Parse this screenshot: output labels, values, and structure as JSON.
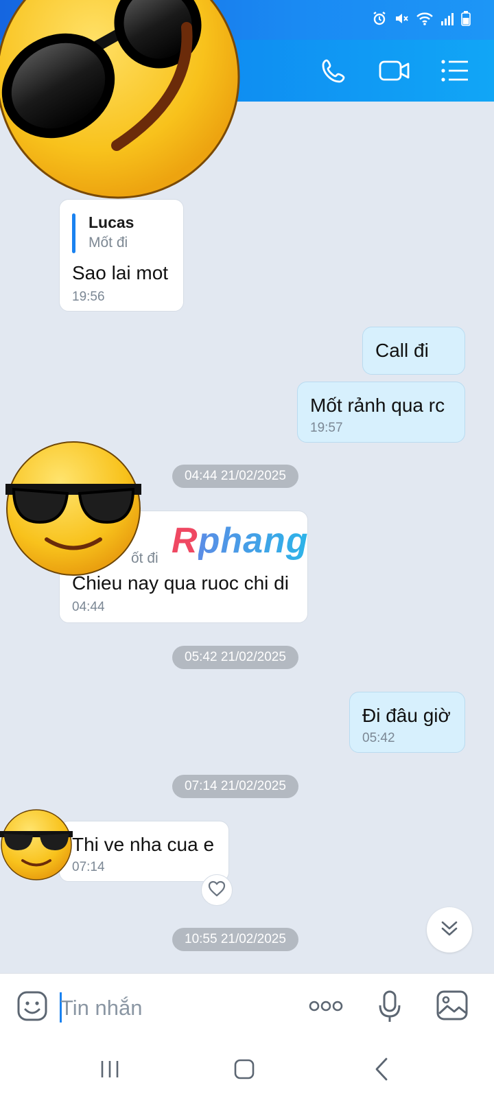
{
  "colors": {
    "accent": "#1a82f0",
    "header_start": "#0e7cf0",
    "header_end": "#11a6f6",
    "chat_bg": "#e2e8f1",
    "outgoing_bubble": "#d7f0fd",
    "incoming_bubble": "#ffffff",
    "date_pill": "#b3b9c1"
  },
  "status_bar": {
    "icons": [
      "alarm-icon",
      "mute-icon",
      "wifi-icon",
      "signal-icon",
      "battery-icon"
    ]
  },
  "header": {
    "actions": [
      "phone-call-icon",
      "video-call-icon",
      "menu-list-icon"
    ]
  },
  "watermark": {
    "r": "R",
    "rest": "phang"
  },
  "messages": [
    {
      "side": "in",
      "quote_name": "Lucas",
      "quote_text": "Mốt đi",
      "text": "Sao lai mot",
      "time": "19:56"
    },
    {
      "side": "out",
      "text": "Call đi",
      "time": ""
    },
    {
      "side": "out",
      "text": "Mốt rảnh qua rc",
      "time": "19:57"
    },
    {
      "side": "in",
      "quote_text": "ốt đi",
      "text": "Chieu nay qua ruoc chi di",
      "time": "04:44"
    },
    {
      "side": "out",
      "text": "Đi đâu giờ",
      "time": "05:42"
    },
    {
      "side": "in",
      "text": "Thi ve nha cua e",
      "time": "07:14"
    }
  ],
  "date_separators": [
    "04:44 21/02/2025",
    "05:42 21/02/2025",
    "07:14 21/02/2025",
    "10:55 21/02/2025"
  ],
  "composer": {
    "placeholder": "Tin nhắn",
    "value": ""
  },
  "nav_bar": {
    "buttons": [
      "recents-icon",
      "home-icon",
      "back-icon"
    ]
  }
}
